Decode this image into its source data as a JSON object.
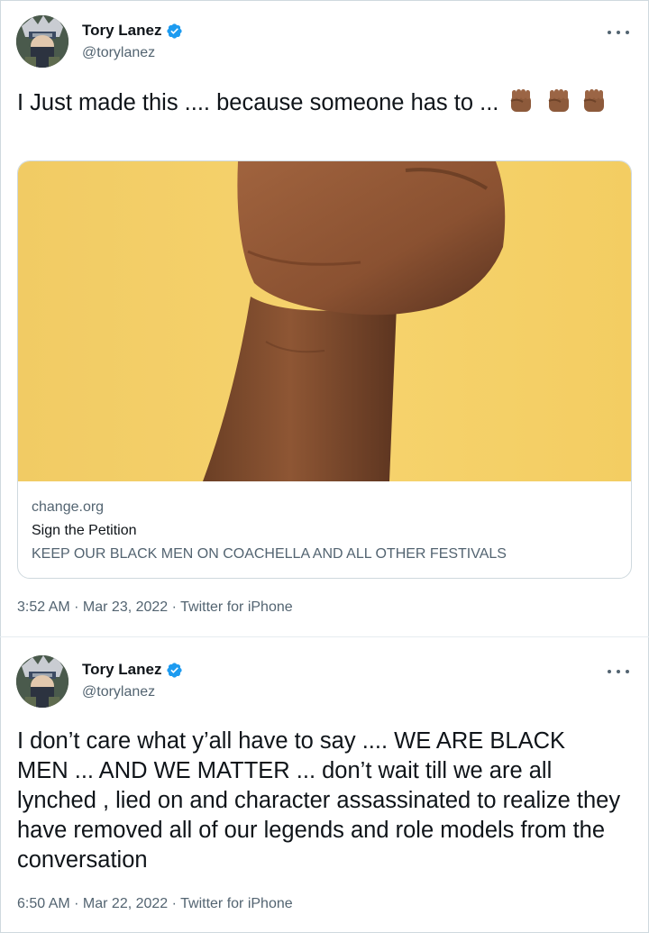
{
  "tweets": [
    {
      "author": {
        "name": "Tory Lanez",
        "handle": "@torylanez",
        "avatar_icon": "avatar-image",
        "verified_icon": "verified-badge-icon"
      },
      "text": "I Just made this .... because someone has to ...",
      "emoji": [
        "raised-fist-medium-dark-skin",
        "raised-fist-medium-dark-skin",
        "raised-fist-medium-dark-skin"
      ],
      "card": {
        "domain": "change.org",
        "title": "Sign the Petition",
        "description": "KEEP OUR BLACK MEN ON COACHELLA AND ALL OTHER FESTIVALS"
      },
      "meta": "3:52 AM · Mar 23, 2022 · Twitter for iPhone"
    },
    {
      "author": {
        "name": "Tory Lanez",
        "handle": "@torylanez",
        "avatar_icon": "avatar-image",
        "verified_icon": "verified-badge-icon"
      },
      "text": "I don’t care what y’all have to say .... WE ARE BLACK MEN ... AND WE MATTER ... don’t wait till we are all lynched , lied on and character assassinated to realize they have removed all of our legends and role models from the conversation",
      "meta": "6:50 AM · Mar 22, 2022 · Twitter for iPhone"
    }
  ],
  "colors": {
    "verified": "#1d9bf0",
    "secondary_text": "#536471",
    "card_background": "#f4cf66"
  }
}
